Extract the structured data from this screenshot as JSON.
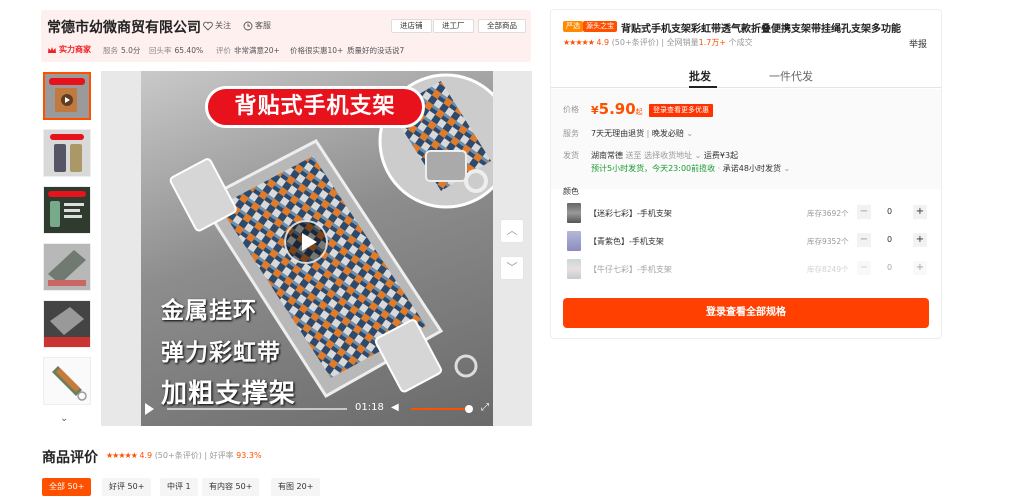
{
  "shop": {
    "name": "常德市幼微商贸有限公司",
    "follow": "关注",
    "service": "客服",
    "buttons": [
      "进店铺",
      "进工厂",
      "全部商品"
    ],
    "strength_badge": "实力商家",
    "stats": [
      {
        "label": "服务",
        "value": "5.0分"
      },
      {
        "label": "回头率",
        "value": "65.40%"
      },
      {
        "label": "评价",
        "value": "非常满意20+"
      },
      {
        "label": "",
        "value": "价格很实惠10+"
      },
      {
        "label": "",
        "value": "质量好的没话说7"
      }
    ]
  },
  "gallery": {
    "thumbnails": [
      "thumb-1",
      "thumb-2",
      "thumb-3",
      "thumb-4",
      "thumb-5",
      "thumb-6"
    ],
    "main_banner": "背贴式手机支架",
    "overlay_lines": [
      "金属挂环",
      "弹力彩虹带",
      "加粗支撑架"
    ],
    "video_time": "01:18",
    "colors": {
      "accent": "#ff5000",
      "banner_red": "#e8121c"
    }
  },
  "reviews": {
    "title": "商品评价",
    "rating": "4.9",
    "count": "(50+条评价)",
    "good_rate_label": "好评率",
    "good_rate": "93.3%",
    "tabs": [
      "全部 50+",
      "好评 50+",
      "中评 1",
      "有内容 50+",
      "有图 20+"
    ]
  },
  "product": {
    "tags": [
      "严选",
      "源头之宝"
    ],
    "title": "背贴式手机支架彩虹带透气款折叠便携支架带挂绳孔支架多功能",
    "rating": "4.9",
    "rating_count": "(50+条评价)",
    "sales_prefix": "全网销量",
    "sales_value": "1.7万+",
    "sales_suffix": "个成交",
    "report": "举报",
    "tabs": [
      "批发",
      "一件代发"
    ],
    "price_label": "价格",
    "price_currency": "¥",
    "price_value": "5.90",
    "price_unit": "起",
    "login_promo": "登录查看更多优惠",
    "service_label": "服务",
    "service_value": "7天无理由退货",
    "service_extra": "晚发必赔",
    "ship_label": "发货",
    "ship_from": "湖南常德",
    "ship_to": "送至",
    "ship_addr": "选择收货地址",
    "ship_fee": "运费¥3起",
    "ship_promise": "预计5小时发货，今天23:00前揽收",
    "ship_48h": "承诺48小时发货",
    "color_label": "颜色",
    "skus": [
      {
        "name": "【迷彩七彩】-手机支架",
        "stock": "库存3692个",
        "qty": "0"
      },
      {
        "name": "【青紫色】-手机支架",
        "stock": "库存9352个",
        "qty": "0"
      },
      {
        "name": "【牛仔七彩】-手机支架",
        "stock": "库存8249个",
        "qty": "0"
      }
    ],
    "cta": "登录查看全部规格"
  }
}
